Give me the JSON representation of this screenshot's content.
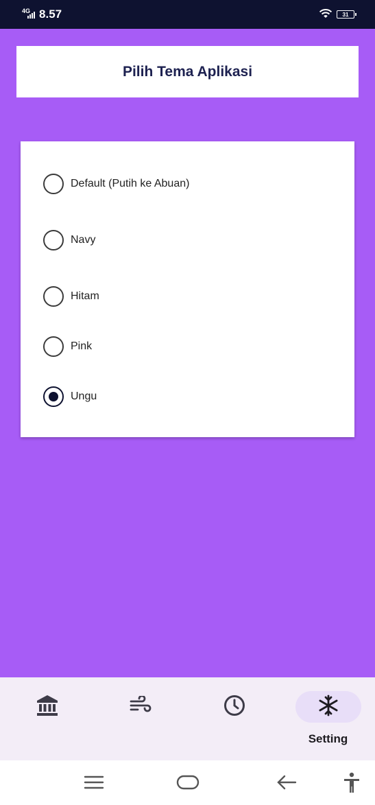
{
  "status_bar": {
    "network": "4G",
    "time": "8.57",
    "battery": "31"
  },
  "header": {
    "title": "Pilih Tema Aplikasi"
  },
  "theme_options": [
    {
      "label": "Default (Putih ke Abuan)",
      "selected": false
    },
    {
      "label": "Navy",
      "selected": false
    },
    {
      "label": "Hitam",
      "selected": false
    },
    {
      "label": "Pink",
      "selected": false
    },
    {
      "label": "Ungu",
      "selected": true
    }
  ],
  "bottom_nav": {
    "items": [
      {
        "icon": "bank-icon",
        "label": ""
      },
      {
        "icon": "wind-icon",
        "label": ""
      },
      {
        "icon": "clock-icon",
        "label": ""
      },
      {
        "icon": "snowflake-icon",
        "label": "Setting",
        "active": true
      }
    ]
  },
  "system_nav": {
    "icons": [
      "menu-icon",
      "home-icon",
      "back-icon",
      "accessibility-icon"
    ]
  },
  "colors": {
    "background": "#a75cf6",
    "status_bar": "#0e1230",
    "accent": "#0e1230",
    "title_text": "#1d2150",
    "nav_bg": "#f3edf7",
    "active_pill": "#e8def8"
  }
}
